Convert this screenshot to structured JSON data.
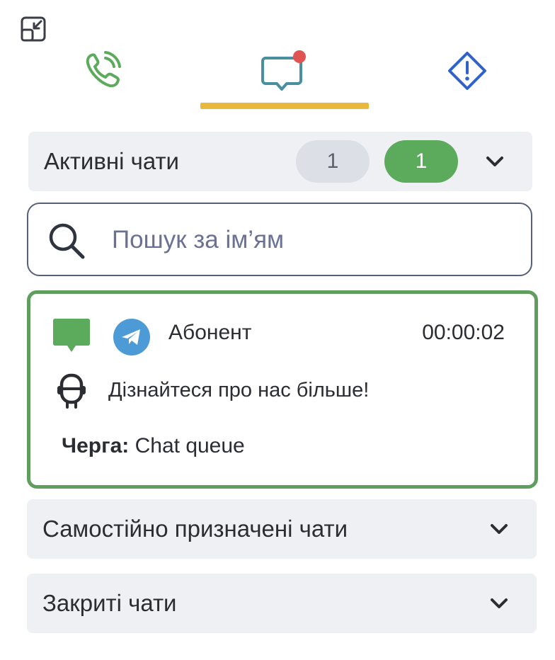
{
  "tabs": [
    {
      "id": "phone",
      "icon": "phone-icon",
      "color": "#5caa5c"
    },
    {
      "id": "chats",
      "icon": "chat-icon",
      "color": "#4a8fa0",
      "has_notification": true,
      "notification_color": "#e05454",
      "active": true
    },
    {
      "id": "alerts",
      "icon": "alert-diamond-icon",
      "color": "#2f63c9"
    }
  ],
  "accent_color": "#e8b93a",
  "sections": {
    "active": {
      "title": "Активні чати",
      "count_total": "1",
      "count_mine": "1"
    },
    "self_assigned": {
      "title": "Самостійно призначені чати"
    },
    "closed": {
      "title": "Закриті чати"
    }
  },
  "search": {
    "placeholder": "Пошук за ім’ям",
    "value": ""
  },
  "chat": {
    "name": "Абонент",
    "timer": "00:00:02",
    "channel_icon": "telegram-icon",
    "message": "Дізнайтеся про нас більше!",
    "queue_label": "Черга:",
    "queue_value": "Chat queue",
    "border_color": "#5f9e5f"
  }
}
